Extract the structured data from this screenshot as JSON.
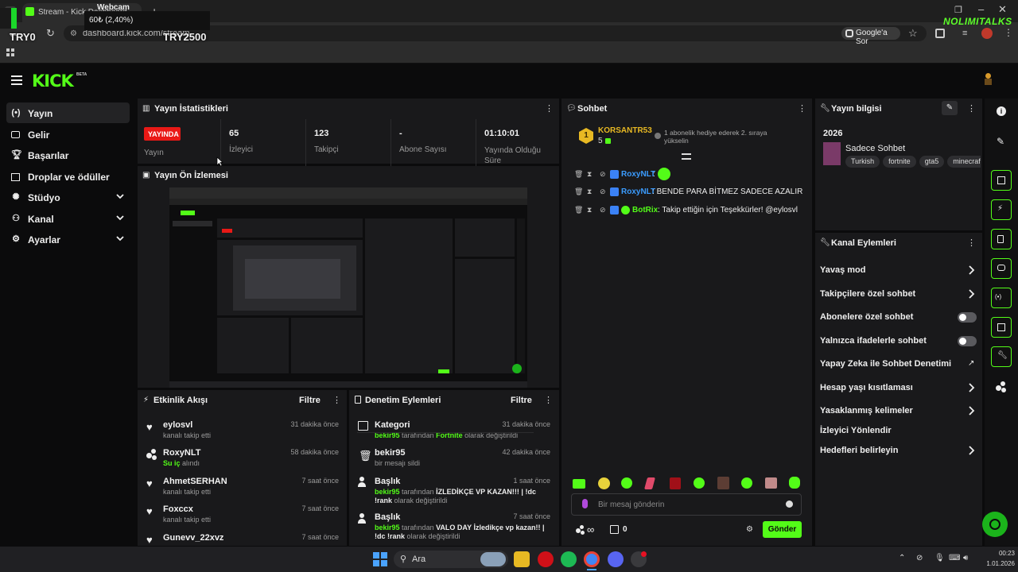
{
  "browser": {
    "tab_title": "Stream - Kick Dashboard",
    "url": "dashboard.kick.com/stream",
    "google_lens": "Google'a Sor"
  },
  "overlay": {
    "webcam": "Webcam",
    "progress_text": "60₺ (2,40%)",
    "progress_value": 2.4,
    "left_text": "TRY0",
    "right_text": "TRY2500",
    "brand": "NOLIMITALKS"
  },
  "header": {
    "logo": "KICK",
    "beta": "BETA"
  },
  "sidebar": {
    "items": [
      {
        "label": "Yayın",
        "icon": "broadcast-icon",
        "active": true
      },
      {
        "label": "Gelir",
        "icon": "wallet-icon"
      },
      {
        "label": "Başarılar",
        "icon": "trophy-icon"
      },
      {
        "label": "Droplar ve ödüller",
        "icon": "gift-icon"
      },
      {
        "label": "Stüdyo",
        "icon": "studio-icon",
        "expandable": true
      },
      {
        "label": "Kanal",
        "icon": "channel-icon",
        "expandable": true
      },
      {
        "label": "Ayarlar",
        "icon": "gear-icon",
        "expandable": true
      }
    ]
  },
  "stats": {
    "title": "Yayın İstatistikleri",
    "live_badge": "YAYINDA",
    "live_label": "Yayın",
    "items": [
      {
        "value": "65",
        "label": "İzleyici"
      },
      {
        "value": "123",
        "label": "Takipçi"
      },
      {
        "value": "-",
        "label": "Abone Sayısı"
      },
      {
        "value": "01:10:01",
        "label": "Yayında Olduğu Süre"
      }
    ]
  },
  "preview": {
    "title": "Yayın Ön İzlemesi"
  },
  "activity": {
    "title": "Etkinlik Akışı",
    "filter": "Filtre",
    "items": [
      {
        "name": "eylosvl",
        "sub": "kanalı takip etti",
        "time": "31 dakika önce",
        "icon": "heart-icon"
      },
      {
        "name": "RoxyNLT",
        "sub_green": "Su iç",
        "sub": "alındı",
        "time": "58 dakika önce",
        "icon": "points-icon"
      },
      {
        "name": "AhmetSERHAN",
        "sub": "kanalı takip etti",
        "time": "7 saat önce",
        "icon": "heart-icon"
      },
      {
        "name": "Foxccx",
        "sub": "kanalı takip etti",
        "time": "7 saat önce",
        "icon": "heart-icon"
      },
      {
        "name": "Gunevv_22xvz",
        "sub": "",
        "time": "7 saat önce",
        "icon": "heart-icon"
      }
    ]
  },
  "moderation": {
    "title": "Denetim Eylemleri",
    "filter": "Filtre",
    "items": [
      {
        "name": "Kategori",
        "user": "bekir95",
        "text1": "tarafından",
        "green2": "Fortnite",
        "text2": "olarak değiştirildi",
        "time": "31 dakika önce",
        "icon": "category-icon"
      },
      {
        "name": "bekir95",
        "text1": "bir mesajı sildi",
        "time": "42 dakika önce",
        "icon": "trash-icon"
      },
      {
        "name": "Başlık",
        "user": "bekir95",
        "text1": "tarafından",
        "bold": "İZLEDİKÇE VP KAZAN!!! | !dc !rank",
        "text2": "olarak değiştirildi",
        "time": "1 saat önce",
        "icon": "user-edit-icon"
      },
      {
        "name": "Başlık",
        "user": "bekir95",
        "text1": "tarafından",
        "bold": "VALO DAY İzledikçe vp kazan!! | !dc !rank",
        "text2": "olarak değiştirildi",
        "time": "7 saat önce",
        "icon": "user-edit-icon"
      }
    ]
  },
  "chat": {
    "title": "Sohbet",
    "pinned_user": "KORSANTR53",
    "pinned_rank": "1",
    "pinned_count": "5",
    "pinned_msg": "1 abonelik hediye ederek 2. sıraya yükselin",
    "messages": [
      {
        "user": "RoxyNLT",
        "text": "",
        "emote": true
      },
      {
        "user": "RoxyNLT",
        "text": "BENDE PARA BİTMEZ SADECE AZALIR"
      },
      {
        "user": "BotRix",
        "text": "Takip ettiğin için Teşekkürler! @eylosvl",
        "bot": true
      }
    ],
    "input_placeholder": "Bir mesaj gönderin",
    "points": "0",
    "send": "Gönder"
  },
  "stream_info": {
    "title": "Yayın bilgisi",
    "year": "2026",
    "category": "Sadece Sohbet",
    "tags": [
      "Turkish",
      "fortnite",
      "gta5",
      "minecraft"
    ]
  },
  "channel_actions": {
    "title": "Kanal Eylemleri",
    "items": [
      {
        "label": "Yavaş mod",
        "control": "chevron"
      },
      {
        "label": "Takipçilere özel sohbet",
        "control": "chevron"
      },
      {
        "label": "Abonelere özel sohbet",
        "control": "toggle"
      },
      {
        "label": "Yalnızca ifadelerle sohbet",
        "control": "toggle"
      },
      {
        "label": "Yapay Zeka ile Sohbet Denetimi",
        "control": "external"
      },
      {
        "label": "Hesap yaşı kısıtlaması",
        "control": "chevron"
      },
      {
        "label": "Yasaklanmış kelimeler",
        "control": "chevron"
      },
      {
        "label": "İzleyici Yönlendir",
        "control": "none"
      },
      {
        "label": "Hedefleri belirleyin",
        "control": "chevron"
      }
    ]
  },
  "taskbar": {
    "search": "Ara",
    "time": "00:23",
    "date": "1.01.2026"
  },
  "colors": {
    "accent": "#53fc18",
    "live": "#e91916",
    "panel": "#19191b"
  }
}
